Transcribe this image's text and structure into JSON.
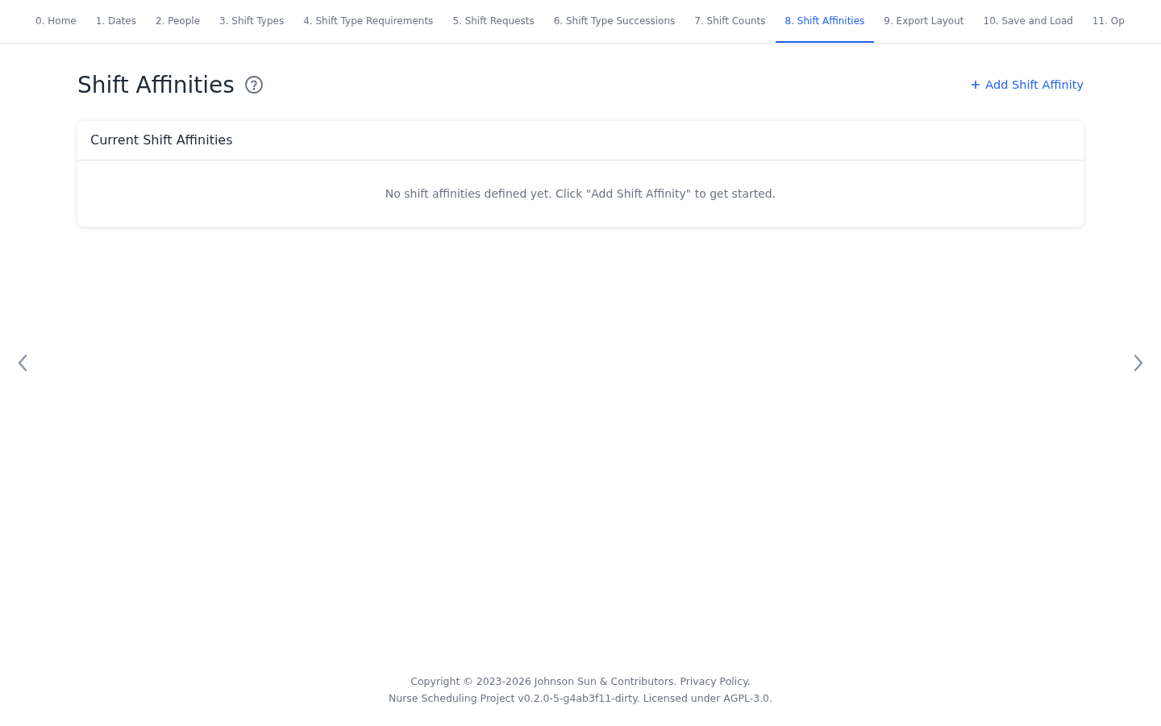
{
  "tabs": [
    {
      "label": "0. Home",
      "selected": false
    },
    {
      "label": "1. Dates",
      "selected": false
    },
    {
      "label": "2. People",
      "selected": false
    },
    {
      "label": "3. Shift Types",
      "selected": false
    },
    {
      "label": "4. Shift Type Requirements",
      "selected": false
    },
    {
      "label": "5. Shift Requests",
      "selected": false
    },
    {
      "label": "6. Shift Type Successions",
      "selected": false
    },
    {
      "label": "7. Shift Counts",
      "selected": false
    },
    {
      "label": "8. Shift Affinities",
      "selected": true
    },
    {
      "label": "9. Export Layout",
      "selected": false
    },
    {
      "label": "10. Save and Load",
      "selected": false
    },
    {
      "label": "11. Op",
      "selected": false
    }
  ],
  "page": {
    "title": "Shift Affinities",
    "add_button": "Add Shift Affinity"
  },
  "card": {
    "title": "Current Shift Affinities",
    "empty_message": "No shift affinities defined yet. Click \"Add Shift Affinity\" to get started."
  },
  "footer": {
    "copyright": "Copyright © 2023-2026 Johnson Sun & Contributors.",
    "privacy_link": "Privacy Policy.",
    "license": "Nurse Scheduling Project v0.2.0-5-g4ab3f11-dirty. Licensed under AGPL-3.0."
  }
}
